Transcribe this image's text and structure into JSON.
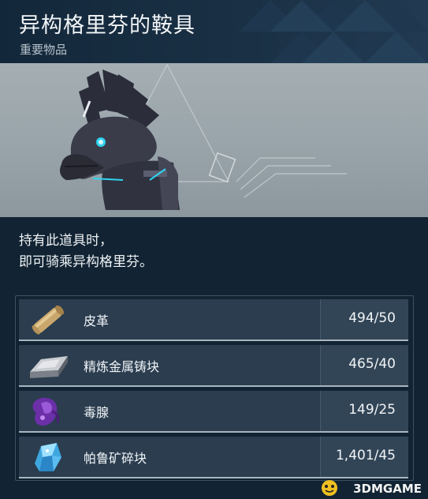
{
  "item": {
    "title": "异构格里芬的鞍具",
    "category": "重要物品",
    "description": [
      "持有此道具时，",
      "即可骑乘异构格里芬。"
    ]
  },
  "materials": [
    {
      "icon": "leather-icon",
      "name": "皮革",
      "count": "494/50"
    },
    {
      "icon": "refined-ingot-icon",
      "name": "精炼金属铸块",
      "count": "465/40"
    },
    {
      "icon": "poison-gland-icon",
      "name": "毒腺",
      "count": "149/25"
    },
    {
      "icon": "paldium-fragment-icon",
      "name": "帕鲁矿碎块",
      "count": "1,401/45"
    }
  ],
  "watermark": "3DMGAME",
  "colors": {
    "header_bg": "#1a3145",
    "preview_bg": "#9aa5ab",
    "panel_bg": "#122433",
    "row_bg": "#2b3d4f",
    "row_underline": "#a8b5bf"
  }
}
